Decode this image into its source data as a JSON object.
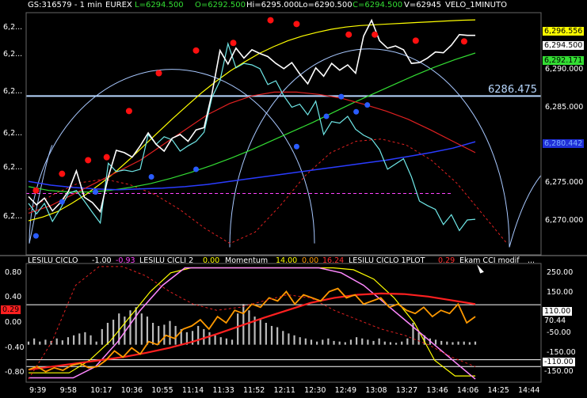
{
  "header": {
    "symbol": "GS:316579 - 1 min",
    "exchange": "EUREX",
    "low": "L=6294.500",
    "open": "O=6292.500",
    "hi": "Hi=6295.000",
    "lo": "Lo=6290.500",
    "close": "C=6294.500",
    "volume": "V=62945",
    "velo": "VELO_1MINUTO"
  },
  "lower_header": {
    "lesilu_label": "LESILU CICLO",
    "lesilu_val": "-1.00",
    "lesilu_val2": "-0.93",
    "cicli2_label": "LESILU CICLI 2",
    "cicli2_val": "0.00",
    "momentum_label": "Momentum",
    "momentum_val": "14.00",
    "momentum_val2": "0.00",
    "momentum_val3": "16.24",
    "plot_label": "LESILU CICLO 1PLOT",
    "plot_val": "0.29",
    "cci_label": "Ekam CCI modif",
    "more": "..."
  },
  "colors": {
    "price": "#ffffff",
    "cyan": "#6fe8e8",
    "yellow": "#ffff00",
    "green": "#33dd33",
    "blue": "#2a3cff",
    "red": "#e02020",
    "arc": "#a8c8ff",
    "level": "#b8d8ff",
    "magenta": "#ff44ff",
    "orange": "#ff9900",
    "hist": "#bbbbbb"
  },
  "chart_data": [
    {
      "type": "line",
      "title": "GS:316579 - 1 min EUREX",
      "xlabel": "",
      "ylabel": "",
      "x_ticks": [
        "9:39",
        "9:58",
        "10:17",
        "10:36",
        "10:55",
        "11:14",
        "11:33",
        "11:52",
        "12:11",
        "12:30",
        "12:49",
        "13:08",
        "13:27",
        "13:46",
        "14:06",
        "14:25",
        "14:44"
      ],
      "y_ticks_right": [
        "6,290.000",
        "6,285.000",
        "6,280.000",
        "6,275.000",
        "6,270.000"
      ],
      "y_ticks_left": [
        "6,2...",
        "6,2...",
        "6,2...",
        "6,2...",
        "6,2...",
        "6,2..."
      ],
      "ylim": [
        6265.5,
        6297.5
      ],
      "level_line": {
        "value": 6286.475,
        "label": "6286.475"
      },
      "right_tags": [
        {
          "label": "6,296.556",
          "value": 6296.556,
          "style": "yellow"
        },
        {
          "label": "6,294.500",
          "value": 6294.5,
          "style": "white"
        },
        {
          "label": "6,292.171",
          "value": 6292.171,
          "style": "green"
        },
        {
          "label": "6,280.442",
          "value": 6280.442,
          "style": "blue"
        }
      ],
      "series": [
        {
          "name": "price",
          "values": [
            6273.2,
            6272.1,
            6273.0,
            6271.3,
            6272.4,
            6273.9,
            6276.6,
            6273.1,
            6272.4,
            6271.2,
            6275.8,
            6279.3,
            6279.0,
            6278.4,
            6279.9,
            6281.6,
            6280.1,
            6279.2,
            6280.9,
            6281.4,
            6280.5,
            6282.0,
            6282.3,
            6286.8,
            6292.5,
            6290.7,
            6292.8,
            6291.5,
            6292.6,
            6292.1,
            6291.7,
            6290.8,
            6290.1,
            6290.9,
            6289.4,
            6288.1,
            6290.2,
            6289.1,
            6290.8,
            6289.9,
            6290.6,
            6289.5,
            6294.4,
            6296.5,
            6293.8,
            6292.8,
            6293.1,
            6292.6,
            6290.8,
            6290.9,
            6291.5,
            6292.3,
            6292.2,
            6293.2,
            6294.6,
            6294.5,
            6294.5
          ]
        },
        {
          "name": "cyan",
          "values": [
            6272.3,
            6270.9,
            6272.3,
            6269.9,
            6271.6,
            6273.6,
            6274.0,
            6272.6,
            6271.1,
            6269.7,
            6277.6,
            6276.5,
            6276.7,
            6276.5,
            6276.8,
            6281.4,
            6280.1,
            6281.1,
            6280.7,
            6279.2,
            6279.9,
            6280.5,
            6281.7,
            6286.3,
            6288.5,
            6293.4,
            6290.2,
            6290.8,
            6290.6,
            6290.1,
            6288.0,
            6288.5,
            6286.5,
            6285.0,
            6285.4,
            6284.0,
            6285.8,
            6281.4,
            6283.1,
            6282.9,
            6283.8,
            6282.1,
            6281.3,
            6280.8,
            6279.4,
            6276.8,
            6277.5,
            6278.2,
            6275.8,
            6272.6,
            6272.0,
            6271.5,
            6269.5,
            6270.8,
            6268.7,
            6270.1,
            6270.2
          ]
        },
        {
          "name": "yellow",
          "values": [
            6270.0,
            6270.5,
            6271.2,
            6272.3,
            6273.5,
            6274.9,
            6276.4,
            6278.1,
            6279.9,
            6281.7,
            6283.5,
            6285.2,
            6286.9,
            6288.4,
            6289.8,
            6291.0,
            6292.1,
            6293.0,
            6293.8,
            6294.4,
            6294.9,
            6295.3,
            6295.6,
            6295.8,
            6295.9,
            6296.0,
            6296.1,
            6296.2,
            6296.3,
            6296.4,
            6296.5,
            6296.55
          ]
        },
        {
          "name": "green",
          "values": [
            6274.5,
            6274.0,
            6273.8,
            6273.8,
            6274.0,
            6274.4,
            6274.9,
            6275.6,
            6276.4,
            6277.3,
            6278.3,
            6279.4,
            6280.6,
            6281.8,
            6283.0,
            6284.3,
            6285.6,
            6286.8,
            6288.0,
            6289.2,
            6290.3,
            6291.3,
            6292.17
          ]
        },
        {
          "name": "blue",
          "values": [
            6275.2,
            6274.7,
            6274.4,
            6274.2,
            6274.1,
            6274.2,
            6274.3,
            6274.5,
            6274.8,
            6275.2,
            6275.6,
            6276.0,
            6276.4,
            6276.8,
            6277.2,
            6277.6,
            6278.0,
            6278.5,
            6279.0,
            6279.6,
            6280.44
          ]
        },
        {
          "name": "red",
          "values": [
            6271.0,
            6272.0,
            6273.5,
            6275.0,
            6276.5,
            6278.0,
            6280.0,
            6282.0,
            6284.0,
            6285.5,
            6286.5,
            6287.0,
            6287.0,
            6286.7,
            6286.2,
            6285.4,
            6284.5,
            6283.4,
            6282.0,
            6280.5,
            6279.0
          ]
        },
        {
          "name": "red-dotted",
          "values": [
            6271.5,
            6273.5,
            6275.0,
            6275.5,
            6274.8,
            6273.5,
            6271.5,
            6269.0,
            6267.0,
            6268.5,
            6272.0,
            6276.0,
            6279.0,
            6280.5,
            6280.8,
            6280.0,
            6278.0,
            6275.0,
            6271.0,
            6267.0
          ]
        }
      ],
      "markers_red": [
        [
          2,
          6274
        ],
        [
          9,
          6276.2
        ],
        [
          16,
          6278
        ],
        [
          21,
          6278.4
        ],
        [
          27,
          6284.5
        ],
        [
          35,
          6289.5
        ],
        [
          45,
          6292.5
        ],
        [
          55,
          6293.5
        ],
        [
          65,
          6296.5
        ],
        [
          72,
          6296
        ],
        [
          86,
          6294.6
        ],
        [
          93,
          6294.6
        ],
        [
          104,
          6293.8
        ],
        [
          117,
          6293.7
        ]
      ],
      "markers_blue": [
        [
          2,
          6268
        ],
        [
          9,
          6272.5
        ],
        [
          18,
          6273.8
        ],
        [
          33,
          6275.8
        ],
        [
          45,
          6276.8
        ],
        [
          72,
          6279.8
        ],
        [
          80,
          6283.8
        ],
        [
          84,
          6286.4
        ],
        [
          88,
          6284.4
        ],
        [
          91,
          6285.3
        ]
      ]
    },
    {
      "type": "line",
      "title": "LESILU CICLO",
      "xlabel": "",
      "ylabel": "",
      "y_ticks_left": [
        "0.80",
        "0.40",
        "0.00",
        "-0.40",
        "-0.80"
      ],
      "y_ticks_right": [
        "250.00",
        "150.00",
        "50.00",
        "-50.00",
        "-150.00"
      ],
      "ylim": [
        -0.95,
        0.95
      ],
      "right_tags": [
        {
          "label": "110.00",
          "value": 110,
          "style": "white"
        },
        {
          "label": "70.44",
          "value": 70.44,
          "style": "black"
        },
        {
          "label": "-110.00",
          "value": -110,
          "style": "white"
        },
        {
          "label": "-150.00",
          "value": -150,
          "style": "black"
        }
      ],
      "left_tag": {
        "label": "0.29",
        "value": 0.29,
        "style": "red"
      },
      "histogram": [
        0.05,
        0.1,
        0.05,
        0.08,
        0.06,
        0.1,
        0.07,
        0.12,
        0.15,
        0.18,
        0.2,
        0.15,
        0.05,
        0.25,
        0.35,
        0.4,
        0.5,
        0.45,
        0.55,
        0.6,
        0.5,
        0.45,
        0.35,
        0.3,
        0.32,
        0.38,
        0.3,
        0.25,
        0.2,
        0.22,
        0.3,
        0.25,
        0.2,
        0.15,
        0.12,
        0.1,
        0.08,
        0.5,
        0.65,
        0.55,
        0.45,
        0.42,
        0.35,
        0.3,
        0.28,
        0.22,
        0.18,
        0.15,
        0.12,
        0.1,
        0.08,
        0.05,
        0.08,
        0.1,
        0.06,
        0.05,
        0.04,
        0.08,
        0.12,
        0.1,
        0.08,
        0.06,
        0.1,
        0.05,
        0.04,
        0.03,
        0.05,
        0.1,
        0.35,
        0.2,
        0.15,
        0.1,
        0.08,
        0.06,
        0.05,
        0.04,
        0.05,
        0.05,
        0.04,
        0.05
      ],
      "series": [
        {
          "name": "orange",
          "values": [
            -0.75,
            -0.7,
            -0.78,
            -0.72,
            -0.76,
            -0.68,
            -0.65,
            -0.72,
            -0.7,
            -0.6,
            -0.45,
            -0.55,
            -0.4,
            -0.5,
            -0.3,
            -0.35,
            -0.2,
            -0.25,
            -0.1,
            -0.05,
            0.05,
            -0.1,
            0.1,
            0.0,
            0.2,
            0.15,
            0.3,
            0.25,
            0.4,
            0.35,
            0.5,
            0.3,
            0.45,
            0.4,
            0.35,
            0.5,
            0.55,
            0.4,
            0.45,
            0.3,
            0.35,
            0.4,
            0.25,
            0.3,
            0.2,
            0.15,
            0.25,
            0.1,
            0.2,
            0.15,
            0.3,
            0.0,
            0.1
          ]
        },
        {
          "name": "yellow-cycle",
          "values": [
            -0.8,
            -0.8,
            -0.8,
            -0.6,
            -0.3,
            0.1,
            0.5,
            0.8,
            0.88,
            0.88,
            0.88,
            0.88,
            0.88,
            0.88,
            0.88,
            0.88,
            0.85,
            0.7,
            0.4,
            0.0,
            -0.6,
            -0.85,
            -0.85
          ]
        },
        {
          "name": "pink-cycle",
          "values": [
            -0.88,
            -0.88,
            -0.88,
            -0.7,
            -0.3,
            0.2,
            0.6,
            0.88,
            0.88,
            0.88,
            0.88,
            0.88,
            0.88,
            0.88,
            0.8,
            0.6,
            0.3,
            0.0,
            -0.3,
            -0.6,
            -0.9
          ]
        },
        {
          "name": "red-trend",
          "values": [
            -0.75,
            -0.7,
            -0.65,
            -0.6,
            -0.55,
            -0.48,
            -0.4,
            -0.3,
            -0.18,
            -0.05,
            0.08,
            0.2,
            0.32,
            0.4,
            0.45,
            0.47,
            0.46,
            0.42,
            0.36,
            0.3
          ]
        }
      ]
    }
  ]
}
